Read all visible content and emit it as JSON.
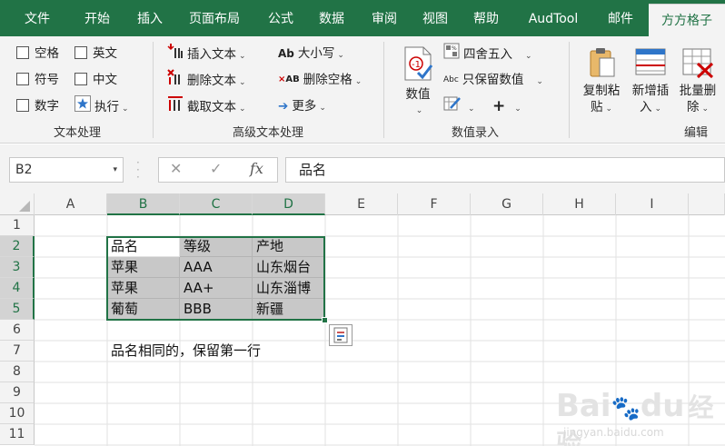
{
  "tabs": [
    {
      "label": "文件",
      "active": false
    },
    {
      "label": "开始",
      "active": false
    },
    {
      "label": "插入",
      "active": false
    },
    {
      "label": "页面布局",
      "active": false
    },
    {
      "label": "公式",
      "active": false
    },
    {
      "label": "数据",
      "active": false
    },
    {
      "label": "审阅",
      "active": false
    },
    {
      "label": "视图",
      "active": false
    },
    {
      "label": "帮助",
      "active": false
    },
    {
      "label": "AudTool",
      "active": false
    },
    {
      "label": "邮件",
      "active": false
    },
    {
      "label": "方方格子",
      "active": true
    }
  ],
  "ribbon": {
    "text_group": {
      "label": "文本处理",
      "items": [
        "空格",
        "英文",
        "符号",
        "中文",
        "数字",
        "执行"
      ]
    },
    "advanced_group": {
      "label": "高级文本处理",
      "insert_text": "插入文本",
      "delete_text": "删除文本",
      "extract_text": "截取文本",
      "case": "大小写",
      "delete_space": "删除空格",
      "more": "更多"
    },
    "number_group": {
      "label": "数值录入",
      "value": "数值",
      "round": "四舍五入",
      "keep_value": "只保留数值"
    },
    "edit_group": {
      "label": "编辑",
      "copy_paste": [
        "复制粘",
        "贴"
      ],
      "add_insert": [
        "新增插",
        "入"
      ],
      "batch_delete": [
        "批量删",
        "除"
      ]
    }
  },
  "formula_bar": {
    "name_box": "B2",
    "content": "品名"
  },
  "sheet": {
    "columns": [
      "A",
      "B",
      "C",
      "D",
      "E",
      "F",
      "G",
      "H",
      "I"
    ],
    "rows": [
      "1",
      "2",
      "3",
      "4",
      "5",
      "6",
      "7",
      "8",
      "9",
      "10",
      "11"
    ],
    "table": [
      [
        "品名",
        "等级",
        "产地"
      ],
      [
        "苹果",
        "AAA",
        "山东烟台"
      ],
      [
        "苹果",
        "AA+",
        "山东淄博"
      ],
      [
        "葡萄",
        "BBB",
        "新疆"
      ]
    ],
    "note": "品名相同的，保留第一行"
  },
  "watermark": {
    "brand": "Bai",
    "suffix": "du",
    "cn": "经验",
    "site": "jingyan.baidu.com"
  }
}
